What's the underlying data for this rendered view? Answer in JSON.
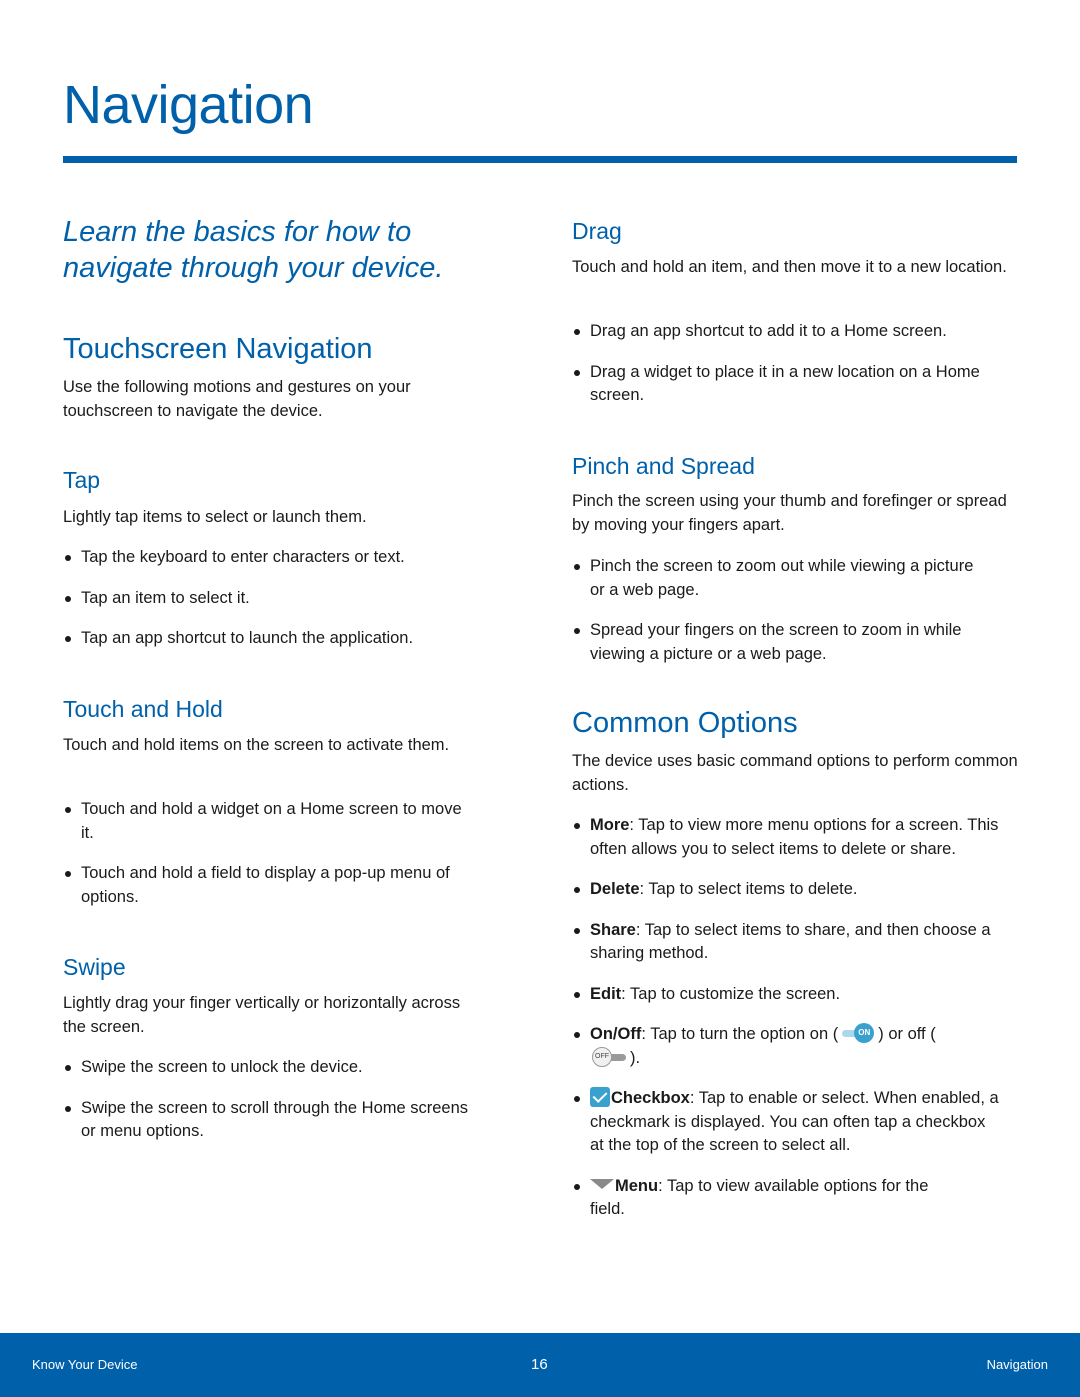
{
  "page": {
    "title": "Navigation",
    "intro": "Learn the basics for how to navigate through your device.",
    "accent_color": "#0060aa"
  },
  "touchscreen": {
    "heading": "Touchscreen Navigation",
    "body": "Use the following motions and gestures on your touchscreen to navigate the device."
  },
  "tap": {
    "heading": "Tap",
    "body": "Lightly tap items to select or launch them.",
    "bullets": [
      "Tap the keyboard to enter characters or text.",
      "Tap an item to select it.",
      "Tap an app shortcut to launch the application."
    ]
  },
  "touch_hold": {
    "heading": "Touch and Hold",
    "body": "Touch and hold items on the screen to activate them.",
    "bullets": [
      "Touch and hold a widget on a Home screen to move it.",
      "Touch and hold a field to display a pop-up menu of options."
    ]
  },
  "swipe": {
    "heading": "Swipe",
    "body": "Lightly drag your finger vertically or horizontally across the screen.",
    "bullets": [
      "Swipe the screen to unlock the device.",
      "Swipe the screen to scroll through the Home screens or menu options."
    ]
  },
  "drag": {
    "heading": "Drag",
    "body": "Touch and hold an item, and then move it to a new location.",
    "bullets": [
      "Drag an app shortcut to add it to a Home screen.",
      "Drag a widget to place it in a new location on a Home screen."
    ]
  },
  "pinch": {
    "heading": "Pinch and Spread",
    "body": "Pinch the screen using your thumb and forefinger or spread by moving your fingers apart.",
    "bullets": [
      "Pinch the screen to zoom out while viewing a picture or a web page.",
      "Spread your fingers on the screen to zoom in while viewing a picture or a web page."
    ]
  },
  "common": {
    "heading": "Common Options",
    "body": "The device uses basic command options to perform common actions.",
    "items": [
      {
        "term": "More",
        "text": ": Tap to view more menu options for a screen. This often allows you to select items to delete or share."
      },
      {
        "term": "Delete",
        "text": ": Tap to select items to delete."
      },
      {
        "term": "Share",
        "text": ": Tap to select items to share, and then choose a sharing method."
      },
      {
        "term": "Edit",
        "text": ": Tap to customize the screen."
      }
    ],
    "onoff": {
      "term": "On/Off",
      "text_before": ": Tap to turn the option on (",
      "text_middle": ") or off (",
      "text_after": ").",
      "on_label": "ON",
      "off_label": "OFF"
    },
    "checkbox": {
      "term": "Checkbox",
      "text": ": Tap to enable or select. When enabled, a checkmark is displayed. You can often tap a checkbox at the top of the screen to select all."
    },
    "menu": {
      "term": "Menu",
      "text": ": Tap to view available options for the field."
    }
  },
  "footer": {
    "left": "Know Your Device",
    "page_number": "16",
    "right": "Navigation"
  }
}
